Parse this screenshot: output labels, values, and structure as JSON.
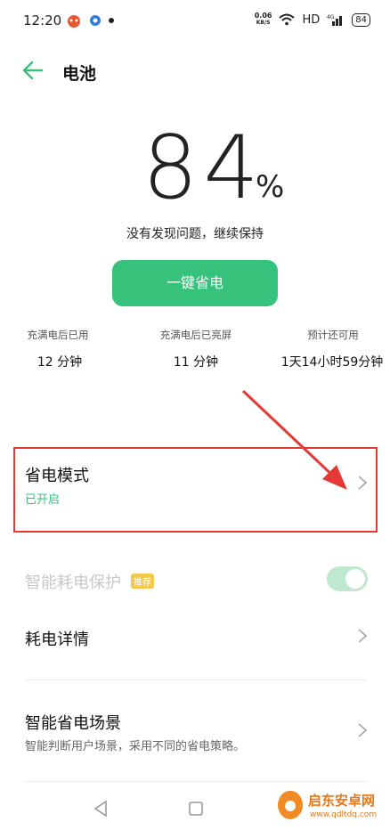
{
  "status_bar": {
    "time": "12:20",
    "net_speed_value": "0.06",
    "net_speed_unit": "KB/S",
    "hd": "HD",
    "signal": "4G",
    "battery": "84"
  },
  "header": {
    "title": "电池"
  },
  "battery": {
    "percent_value": "84",
    "percent_sign": "%",
    "status_message": "没有发现问题，继续保持",
    "one_tap_save": "一键省电"
  },
  "stats": [
    {
      "label": "充满电后已用",
      "value": "12 分钟"
    },
    {
      "label": "充满电后已亮屏",
      "value": "11 分钟"
    },
    {
      "label": "预计还可用",
      "value": "1天14小时59分钟"
    }
  ],
  "power_saving": {
    "title": "省电模式",
    "state": "已开启"
  },
  "smart_protect": {
    "title": "智能耗电保护",
    "badge": "推荐",
    "enabled": true
  },
  "usage_details": {
    "title": "耗电详情"
  },
  "smart_scene": {
    "title": "智能省电场景",
    "desc": "智能判断用户场景，采用不同的省电策略。"
  },
  "watermark": {
    "name": "启东安卓网",
    "url": "www.qdltdq.com"
  },
  "colors": {
    "accent": "#36c27a",
    "highlight": "#e53935"
  }
}
